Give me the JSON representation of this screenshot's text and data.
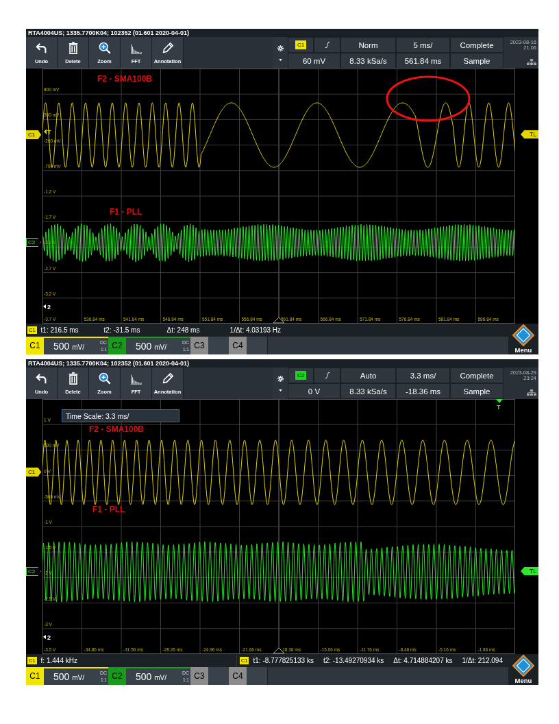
{
  "screens": [
    {
      "title": "RTA4004US; 1335.7700K04; 102352 (01.601 2020-04-01)",
      "tools": [
        {
          "label": "Undo",
          "kind": "undo"
        },
        {
          "label": "Delete",
          "kind": "delete"
        },
        {
          "label": "Zoom",
          "kind": "zoom"
        },
        {
          "label": "FFT",
          "kind": "fft"
        },
        {
          "label": "Annotation",
          "kind": "annotation"
        }
      ],
      "trigger": {
        "source": "C1",
        "color": "#f2e600",
        "mode": "Norm",
        "timebase": "5 ms/",
        "acquisition": "Complete",
        "level": "60 mV",
        "sample_rate": "8.33 kSa/s",
        "position": "561.84 ms",
        "acq_mode": "Sample"
      },
      "date": "2023-08-16",
      "time": "21:06",
      "plot": {
        "y_labels": [
          "800 mV",
          "300 mV",
          "-200 mV",
          "-700 mV",
          "-1.2 V",
          "-1.7 V",
          "-2.2 V",
          "-2.7 V",
          "-3.2 V",
          "-3.7 V"
        ],
        "x_labels": [
          "536.84 ms",
          "541.84 ms",
          "546.84 ms",
          "551.84 ms",
          "556.84 ms",
          "561.84 ms",
          "566.84 ms",
          "571.84 ms",
          "576.84 ms",
          "581.84 ms",
          "586.84 ms"
        ],
        "traces": [
          {
            "label": "F2 - SMA100B",
            "channel": "C1",
            "color": "#e6d600",
            "selected": true
          },
          {
            "label": "F1 - PLL",
            "channel": "C2",
            "color": "#2ee62e",
            "selected": false
          }
        ],
        "trigger_marker": {
          "label": "T",
          "kind": "left"
        },
        "level_marker": {
          "label": "TL",
          "color": "#e6d600"
        },
        "ref_marker": "2",
        "annotations": [
          {
            "kind": "ellipse"
          }
        ]
      },
      "cursor_groups": [
        {
          "source": "C1",
          "color": "#f2e600",
          "items": [
            "t1: 216.5 ms",
            "t2: -31.5 ms",
            "Δt: 248 ms",
            "1/Δt: 4.03193 Hz"
          ]
        }
      ],
      "channels": [
        {
          "label": "C1",
          "color": "#f2e600",
          "on": true,
          "scale": "500",
          "unit": "mV/",
          "coupling": "DC",
          "ratio": "1:1"
        },
        {
          "label": "C2",
          "color": "#1a9a1a",
          "on": true,
          "scale": "500",
          "unit": "mV/",
          "coupling": "DC",
          "ratio": "1:1"
        },
        {
          "label": "C3",
          "color": "#8c8c8c",
          "on": false
        },
        {
          "label": "C4",
          "color": "#8c8c8c",
          "on": false
        }
      ],
      "menu": "Menu"
    },
    {
      "title": "RTA4004US; 1335.7700K04; 102352 (01.601 2020-04-01)",
      "tools": [
        {
          "label": "Undo",
          "kind": "undo"
        },
        {
          "label": "Delete",
          "kind": "delete"
        },
        {
          "label": "Zoom",
          "kind": "zoom"
        },
        {
          "label": "FFT",
          "kind": "fft"
        },
        {
          "label": "Annotation",
          "kind": "annotation"
        }
      ],
      "trigger": {
        "source": "C2",
        "color": "#22d022",
        "mode": "Auto",
        "timebase": "3.3 ms/",
        "acquisition": "Complete",
        "level": "0 V",
        "sample_rate": "8.33 kSa/s",
        "position": "-18.36 ms",
        "acq_mode": "Sample"
      },
      "date": "2023-08-29",
      "time": "23:24",
      "plot": {
        "y_labels": [
          "1 V",
          "500 mV",
          "0 V",
          "-500 mV",
          "-1 V",
          "-1.5 V",
          "-2 V",
          "-2.5 V",
          "-3 V",
          "-3.5 V"
        ],
        "x_labels": [
          "-34.86 ms",
          "-31.56 ms",
          "-28.26 ms",
          "-24.96 ms",
          "-21.66 ms",
          "-18.36 ms",
          "-15.06 ms",
          "-11.76 ms",
          "-8.46 ms",
          "-5.16 ms",
          "-1.86 ms"
        ],
        "traces": [
          {
            "label": "F2  - SMA100B",
            "channel": "C1",
            "color": "#e6d600",
            "selected": true
          },
          {
            "label": "F1 - PLL",
            "channel": "C2",
            "color": "#2ee62e",
            "selected": false
          }
        ],
        "trigger_marker": {
          "label": "T",
          "kind": "top"
        },
        "level_marker": {
          "label": "TL",
          "color": "#2ee62e"
        },
        "ref_marker": "2",
        "overlay": "Time Scale: 3.3 ms/"
      },
      "cursor_groups": [
        {
          "source": "C1",
          "color": "#f2e600",
          "items": [
            "f: 1.444 kHz"
          ]
        },
        {
          "source": "C1",
          "color": "#f2e600",
          "items": [
            "t1: -8.777825133 ks",
            "t2: -13.49270934 ks",
            "Δt: 4.714884207 ks",
            "1/Δt: 212.094"
          ]
        }
      ],
      "channels": [
        {
          "label": "C1",
          "color": "#f2e600",
          "on": true,
          "scale": "500",
          "unit": "mV/",
          "coupling": "DC",
          "ratio": "1:1"
        },
        {
          "label": "C2",
          "color": "#1a9a1a",
          "on": true,
          "scale": "500",
          "unit": "mV/",
          "coupling": "DC",
          "ratio": "1:1"
        },
        {
          "label": "C3",
          "color": "#8c8c8c",
          "on": false
        },
        {
          "label": "C4",
          "color": "#8c8c8c",
          "on": false
        }
      ],
      "menu": "Menu"
    }
  ]
}
